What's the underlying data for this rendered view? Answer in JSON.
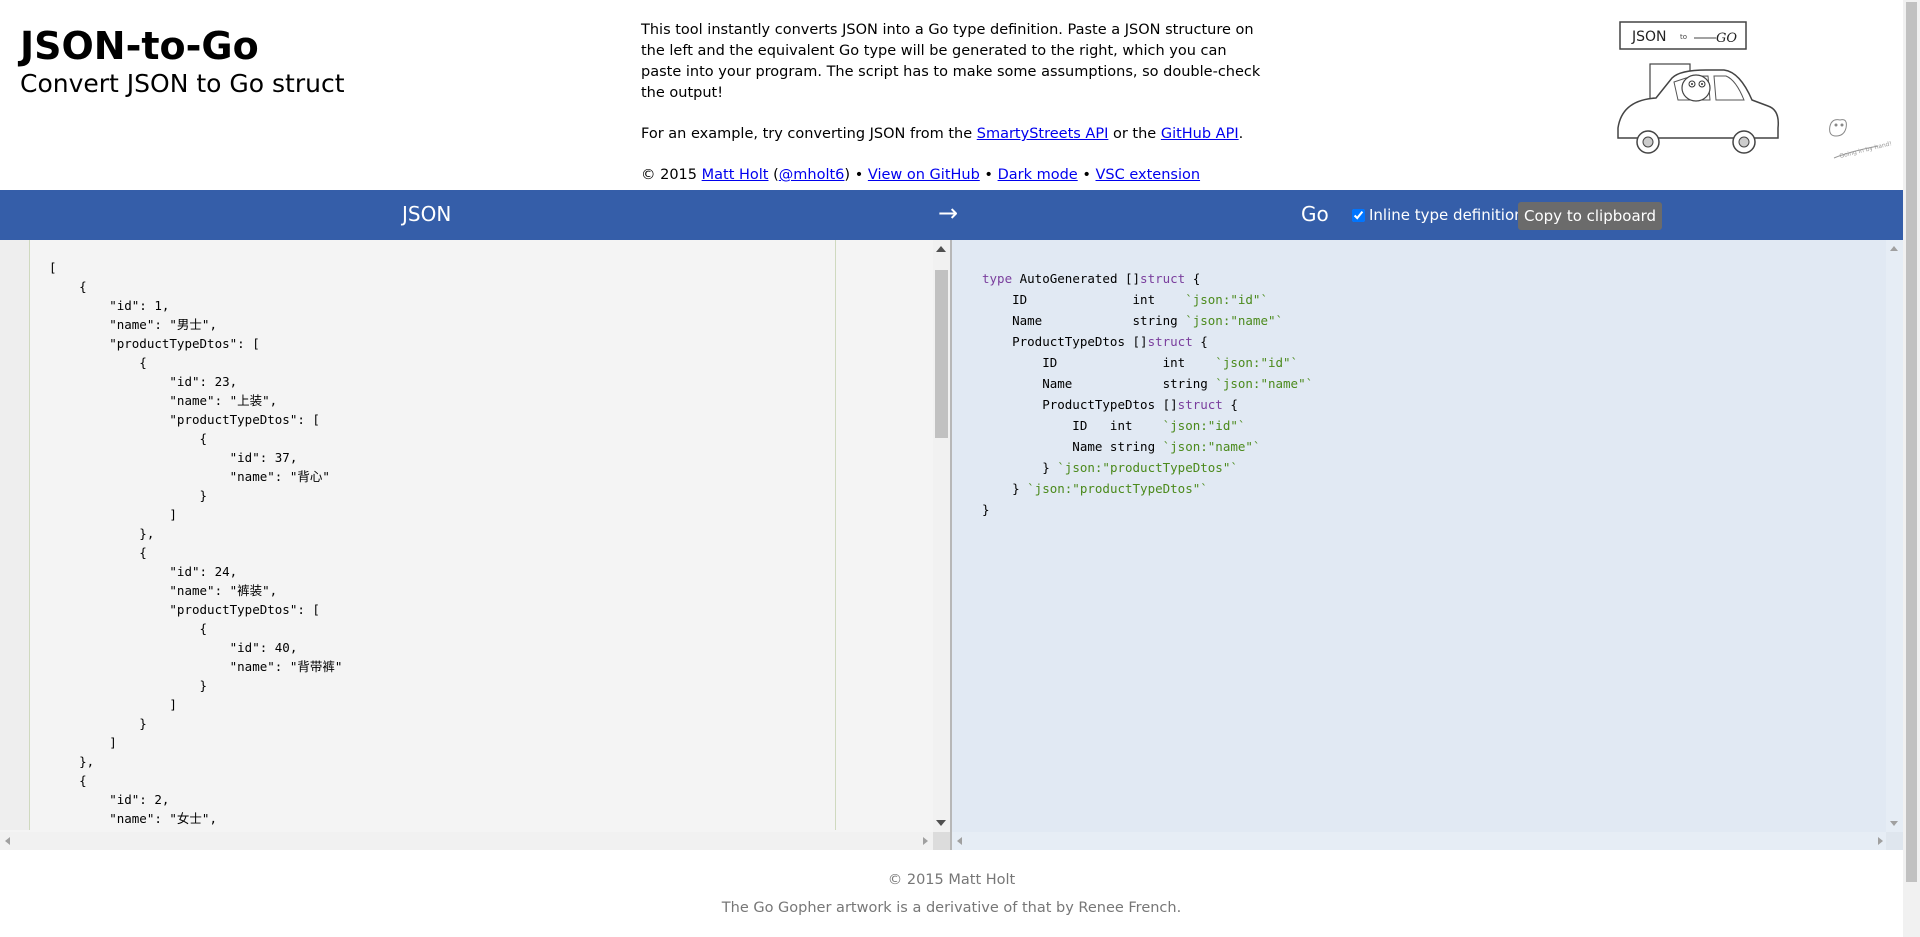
{
  "header": {
    "title": "JSON-to-Go",
    "subtitle": "Convert JSON to Go struct",
    "description": "This tool instantly converts JSON into a Go type definition. Paste a JSON structure on the left and the equivalent Go type will be generated to the right, which you can paste into your program. The script has to make some assumptions, so double-check the output!",
    "example": {
      "prefix": "For an example, try converting JSON from the ",
      "link1": "SmartyStreets API",
      "middle": " or the ",
      "link2": "GitHub API",
      "suffix": "."
    },
    "credits": {
      "copyright": "© 2015 ",
      "author": "Matt Holt",
      "open_paren": " (",
      "handle": "@mholt6",
      "close_paren": ") • ",
      "github": "View on GitHub",
      "sep1": " • ",
      "dark": "Dark mode",
      "sep2": " • ",
      "vsc": "VSC extension"
    },
    "artwork_label": "JSON",
    "artwork_label2": "GO",
    "artwork_icon": "gopher-car-illustration"
  },
  "toolbar": {
    "json_title": "JSON",
    "arrow": "→",
    "go_title": "Go",
    "inline_label": "Inline type definitions",
    "inline_checked": true,
    "copy_label": "Copy to clipboard"
  },
  "json_input": [
    "[",
    "    {",
    "        \"id\": 1,",
    "        \"name\": \"男士\",",
    "        \"productTypeDtos\": [",
    "            {",
    "                \"id\": 23,",
    "                \"name\": \"上装\",",
    "                \"productTypeDtos\": [",
    "                    {",
    "                        \"id\": 37,",
    "                        \"name\": \"背心\"",
    "                    }",
    "                ]",
    "            },",
    "            {",
    "                \"id\": 24,",
    "                \"name\": \"裤装\",",
    "                \"productTypeDtos\": [",
    "                    {",
    "                        \"id\": 40,",
    "                        \"name\": \"背带裤\"",
    "                    }",
    "                ]",
    "            }",
    "        ]",
    "    },",
    "    {",
    "        \"id\": 2,",
    "        \"name\": \"女士\","
  ],
  "go_output": [
    [
      {
        "t": "type",
        "c": "kw"
      },
      {
        "t": " AutoGenerated []"
      },
      {
        "t": "struct",
        "c": "kw"
      },
      {
        "t": " {"
      }
    ],
    [
      {
        "t": "    ID              int    "
      },
      {
        "t": "`json:\"id\"`",
        "c": "tag"
      }
    ],
    [
      {
        "t": "    Name            string "
      },
      {
        "t": "`json:\"name\"`",
        "c": "tag"
      }
    ],
    [
      {
        "t": "    ProductTypeDtos []"
      },
      {
        "t": "struct",
        "c": "kw"
      },
      {
        "t": " {"
      }
    ],
    [
      {
        "t": "        ID              int    "
      },
      {
        "t": "`json:\"id\"`",
        "c": "tag"
      }
    ],
    [
      {
        "t": "        Name            string "
      },
      {
        "t": "`json:\"name\"`",
        "c": "tag"
      }
    ],
    [
      {
        "t": "        ProductTypeDtos []"
      },
      {
        "t": "struct",
        "c": "kw"
      },
      {
        "t": " {"
      }
    ],
    [
      {
        "t": "            ID   int    "
      },
      {
        "t": "`json:\"id\"`",
        "c": "tag"
      }
    ],
    [
      {
        "t": "            Name string "
      },
      {
        "t": "`json:\"name\"`",
        "c": "tag"
      }
    ],
    [
      {
        "t": "        } "
      },
      {
        "t": "`json:\"productTypeDtos\"`",
        "c": "tag"
      }
    ],
    [
      {
        "t": "    } "
      },
      {
        "t": "`json:\"productTypeDtos\"`",
        "c": "tag"
      }
    ],
    [
      {
        "t": "}"
      }
    ]
  ],
  "footer": {
    "copyright": "© 2015 Matt Holt",
    "gopher_credit": "The Go Gopher artwork is a derivative of that by Renee French."
  },
  "colors": {
    "toolbar": "#355ea9",
    "left_pane": "#f4f4f4",
    "right_pane": "#e1e9f3",
    "keyword": "#7a3e9d",
    "tag": "#4b8a1c"
  }
}
